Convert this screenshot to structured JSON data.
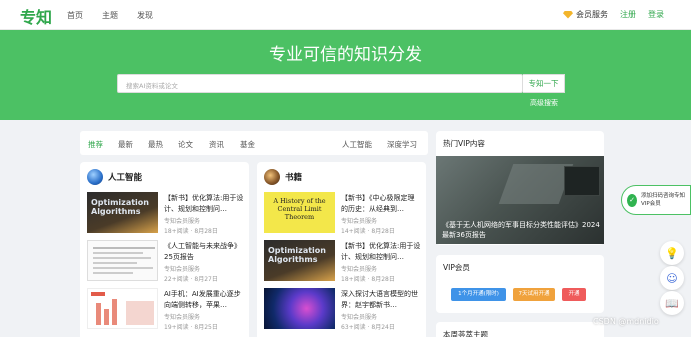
{
  "nav": {
    "logo": "专知",
    "links": [
      "首页",
      "主题",
      "发现"
    ],
    "vip": "会员服务",
    "register": "注册",
    "login": "登录"
  },
  "hero": {
    "title": "专业可信的知识分发",
    "search_placeholder": "搜索AI资料或论文",
    "search_button": "专知一下",
    "advanced": "高级搜索"
  },
  "filters": {
    "left": [
      "推荐",
      "最新",
      "最热",
      "论文",
      "资讯",
      "基金"
    ],
    "right": [
      "人工智能",
      "深度学习"
    ]
  },
  "col_ai": {
    "title": "人工智能",
    "articles": [
      {
        "title": "【新书】优化算法:用于设计、规划和控制问…",
        "source": "专知会员服务",
        "meta": "18+阅读 · 8月28日"
      },
      {
        "title": "《人工智能与未来战争》25页报告",
        "source": "专知会员服务",
        "meta": "22+阅读 · 8月27日"
      },
      {
        "title": "AI手机：AI发展重心逐步向端侧转移，苹果…",
        "source": "专知会员服务",
        "meta": "19+阅读 · 8月25日"
      }
    ]
  },
  "col_books": {
    "title": "书籍",
    "articles": [
      {
        "title": "【新书】《中心极限定理的历史：从经典到…",
        "source": "专知会员服务",
        "meta": "14+阅读 · 8月28日",
        "thumb_title": "A History of the Central Limit Theorem"
      },
      {
        "title": "【新书】优化算法:用于设计、规划和控制问…",
        "source": "专知会员服务",
        "meta": "18+阅读 · 8月28日"
      },
      {
        "title": "深入探讨大语言模型的世界：赵宇都新书…",
        "source": "专知会员服务",
        "meta": "63+阅读 · 8月24日"
      }
    ]
  },
  "side": {
    "hot_title": "热门VIP内容",
    "hot_caption": "《基于无人机网络的军事目标分类性能评估》2024最新36页报告",
    "vip_title": "VIP会员",
    "vip_buttons": [
      "1个月开通(限时)",
      "7天试用开通",
      "开通"
    ],
    "weekly_title": "本周荟萃主题"
  },
  "float": {
    "chat": "添加扫码咨询专知VIP会员"
  },
  "watermark": "CSDN @mdnidio",
  "colors": {
    "brand": "#30a74c",
    "hero": "#4cc164",
    "btn_blue": "#3f93e8",
    "btn_orange": "#f0a23c",
    "btn_red": "#ef5b5b"
  }
}
